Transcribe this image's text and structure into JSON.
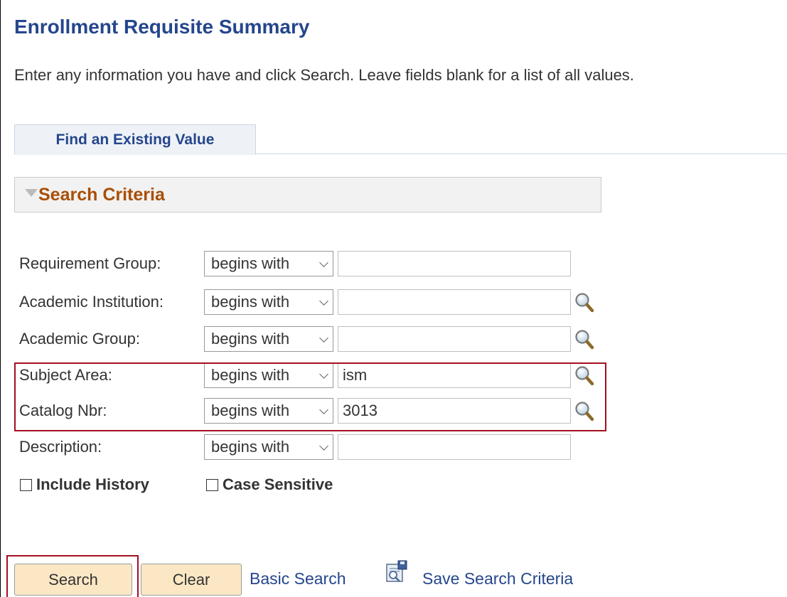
{
  "page": {
    "title": "Enrollment Requisite Summary",
    "instructions": "Enter any information you have and click Search. Leave fields blank for a list of all values."
  },
  "tabs": [
    {
      "label": "Find an Existing Value",
      "active": true
    }
  ],
  "search_criteria": {
    "title": "Search Criteria",
    "fields": [
      {
        "label": "Requirement Group:",
        "operator": "begins with",
        "value": "",
        "lookup_icon": ""
      },
      {
        "label": "Academic Institution:",
        "operator": "begins with",
        "value": "",
        "lookup_icon": "magnifier-icon"
      },
      {
        "label": "Academic Group:",
        "operator": "begins with",
        "value": "",
        "lookup_icon": "magnifier-icon"
      },
      {
        "label": "Subject Area:",
        "operator": "begins with",
        "value": "ism",
        "lookup_icon": "magnifier-icon"
      },
      {
        "label": "Catalog Nbr:",
        "operator": "begins with",
        "value": "3013",
        "lookup_icon": "magnifier-icon"
      },
      {
        "label": "Description:",
        "operator": "begins with",
        "value": "",
        "lookup_icon": ""
      }
    ],
    "checkboxes": [
      {
        "label": "Include History",
        "checked": false
      },
      {
        "label": "Case Sensitive",
        "checked": false
      }
    ]
  },
  "actions": {
    "search_label": "Search",
    "clear_label": "Clear",
    "basic_search_label": "Basic Search",
    "save_search_label": "Save Search Criteria",
    "save_search_icon": "save-search-icon"
  },
  "colors": {
    "title": "#25468c",
    "section_title": "#a94f06",
    "button_bg": "#fbe7c4",
    "highlight": "#a30f20",
    "link": "#25468c"
  }
}
